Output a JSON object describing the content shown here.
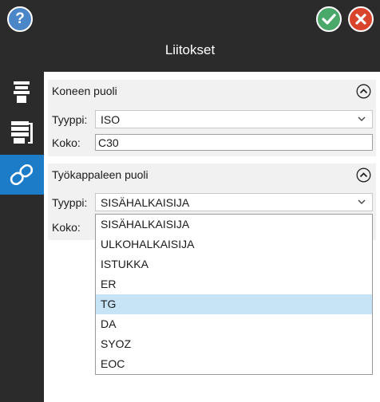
{
  "header": {
    "title": "Liitokset",
    "help_symbol": "?",
    "icons": [
      "help-icon",
      "checkmark-icon",
      "close-icon"
    ],
    "colors": {
      "help": "#4a86c8",
      "ok": "#4aa86a",
      "cancel": "#d8442c",
      "accent": "#1d7cc8"
    }
  },
  "sidebar": {
    "items": [
      {
        "icon": "spindle-icon",
        "selected": false
      },
      {
        "icon": "holder-icon",
        "selected": false
      },
      {
        "icon": "link-icon",
        "selected": true
      }
    ]
  },
  "machine_side": {
    "heading": "Koneen puoli",
    "type_label": "Tyyppi:",
    "type_value": "ISO",
    "size_label": "Koko:",
    "size_value": "C30"
  },
  "work_side": {
    "heading": "Työkappaleen puoli",
    "type_label": "Tyyppi:",
    "type_value": "SISÄHALKAISIJA",
    "size_label": "Koko:"
  },
  "dropdown": {
    "options": [
      "SISÄHALKAISIJA",
      "ULKOHALKAISIJA",
      "ISTUKKA",
      "ER",
      "TG",
      "DA",
      "SYOZ",
      "EOC"
    ],
    "highlighted": "TG"
  }
}
